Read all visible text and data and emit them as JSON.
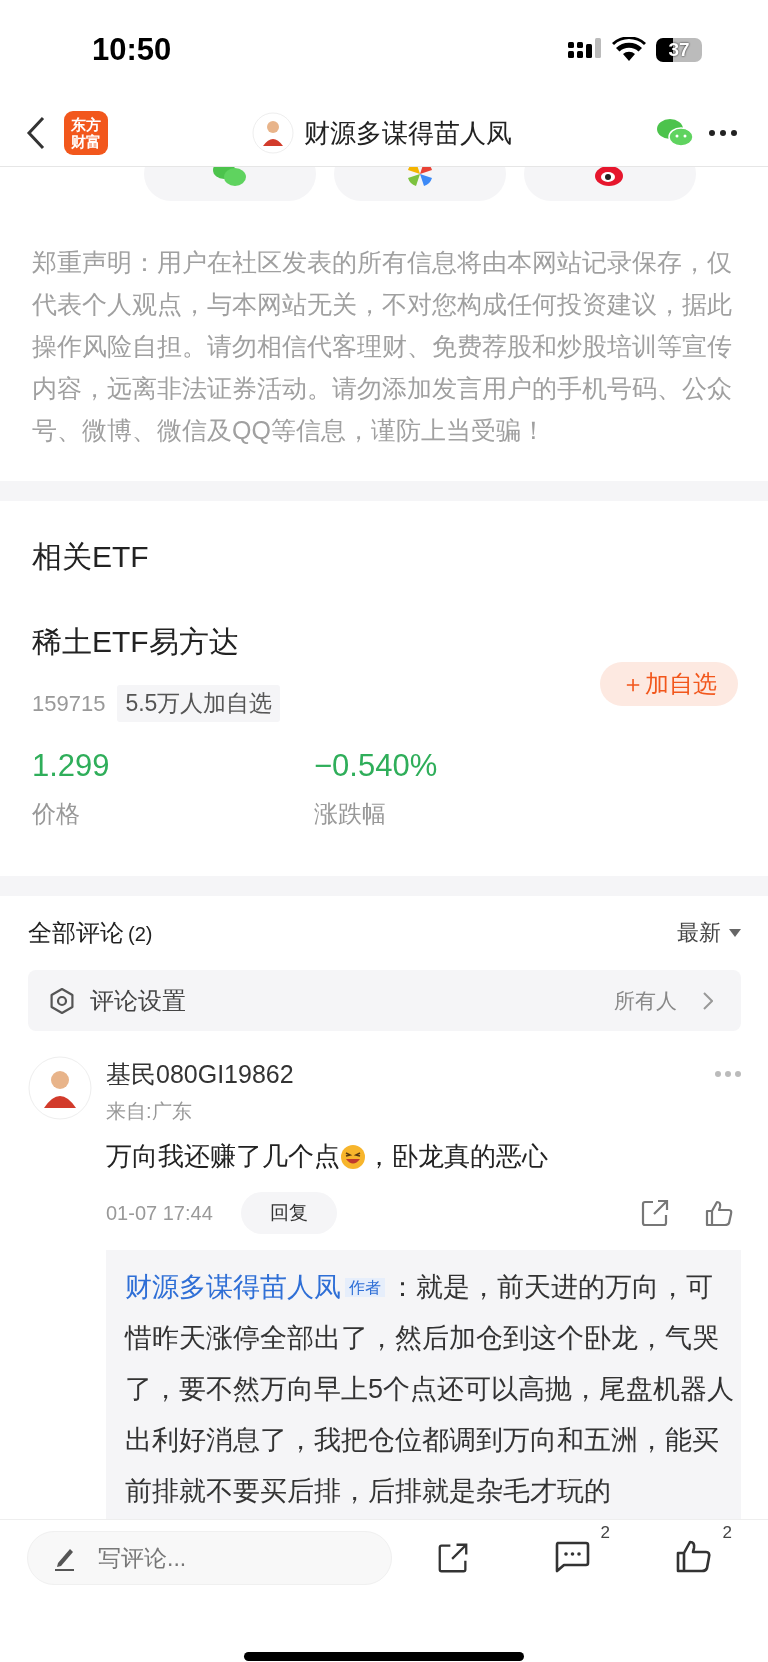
{
  "status_bar": {
    "time": "10:50",
    "battery": "37"
  },
  "nav": {
    "logo": [
      "东方",
      "财富"
    ],
    "title": "财源多谋得苗人凤"
  },
  "share": {
    "targets": [
      {
        "kind": "wechat"
      },
      {
        "kind": "moments"
      },
      {
        "kind": "weibo"
      }
    ]
  },
  "disclaimer": "郑重声明：用户在社区发表的所有信息将由本网站记录保存，仅代表个人观点，与本网站无关，不对您构成任何投资建议，据此操作风险自担。请勿相信代客理财、免费荐股和炒股培训等宣传内容，远离非法证券活动。请勿添加发言用户的手机号码、公众号、微博、微信及QQ等信息，谨防上当受骗！",
  "etf": {
    "heading": "相关ETF",
    "name": "稀土ETF易方达",
    "code": "159715",
    "followers": "5.5万人加自选",
    "add_button": "＋加自选",
    "stats": [
      {
        "value": "1.299",
        "label": "价格"
      },
      {
        "value": "−0.540%",
        "label": "涨跌幅"
      }
    ]
  },
  "comments": {
    "title": "全部评论",
    "count": "(2)",
    "sort": "最新",
    "settings": {
      "label": "评论设置",
      "value": "所有人"
    },
    "items": [
      {
        "user": "基民080GI19862",
        "location": "来自:广东",
        "text_before": "万向我还赚了几个点",
        "text_after": "，卧龙真的恶心",
        "time": "01-07 17:44",
        "reply_button": "回复",
        "replies": [
          {
            "author": "财源多谋得苗人凤",
            "badge": "作者",
            "text": "：就是，前天进的万向，可惜昨天涨停全部出了，然后加仓到这个卧龙，气哭了，要不然万向早上5个点还可以高抛，尾盘机器人出利好消息了，我把仓位都调到万向和五洲，能买前排就不要买后排，后排就是杂毛才玩的"
          }
        ]
      }
    ]
  },
  "bottom_bar": {
    "placeholder": "写评论...",
    "comment_count": "2",
    "like_count": "2"
  }
}
